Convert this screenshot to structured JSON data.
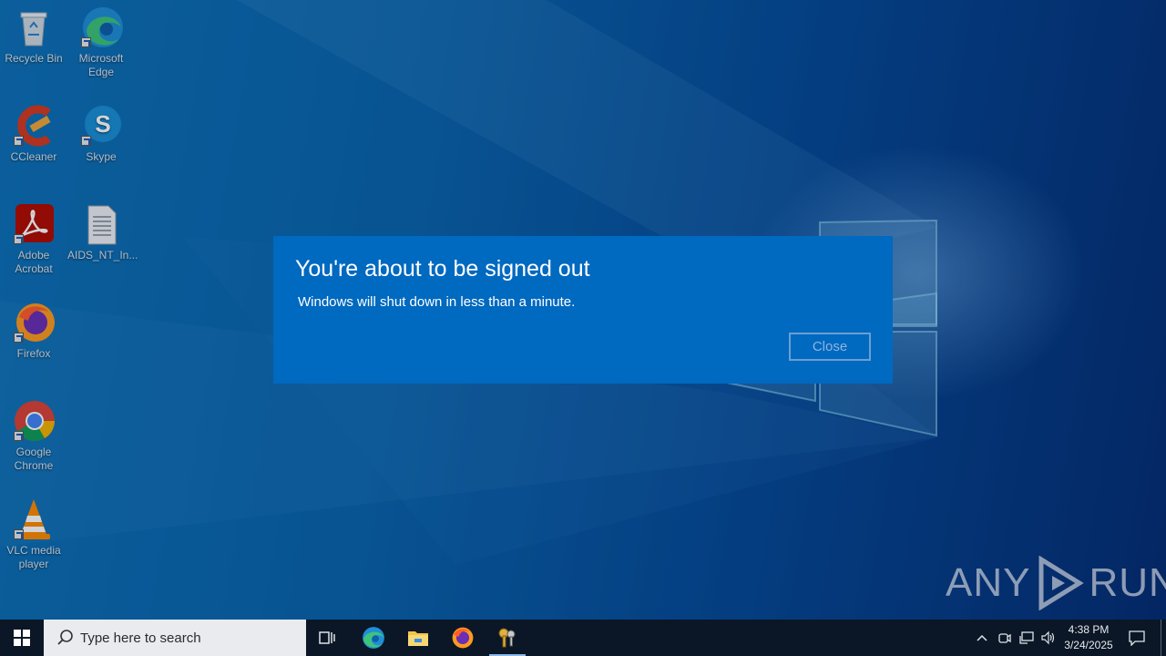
{
  "desktop": {
    "icons": [
      {
        "label": "Recycle Bin",
        "icon": "recycle-bin-icon"
      },
      {
        "label": "Microsoft Edge",
        "icon": "edge-icon"
      },
      {
        "label": "CCleaner",
        "icon": "ccleaner-icon"
      },
      {
        "label": "Skype",
        "icon": "skype-icon"
      },
      {
        "label": "Adobe Acrobat",
        "icon": "acrobat-icon"
      },
      {
        "label": "AIDS_NT_In...",
        "icon": "text-file-icon"
      },
      {
        "label": "Firefox",
        "icon": "firefox-icon"
      },
      {
        "label": "Google Chrome",
        "icon": "chrome-icon"
      },
      {
        "label": "VLC media player",
        "icon": "vlc-icon"
      }
    ]
  },
  "dialog": {
    "title": "You're about to be signed out",
    "message": "Windows will shut down in less than a minute.",
    "close_label": "Close",
    "background_color": "#0069c0"
  },
  "watermark": {
    "left": "ANY",
    "right": "RUN"
  },
  "taskbar": {
    "search_placeholder": "Type here to search",
    "pinned": [
      "task-view-icon",
      "edge-icon",
      "file-explorer-icon",
      "firefox-icon",
      "keys-app-icon"
    ],
    "clock_time": "4:38 PM",
    "clock_date": "3/24/2025"
  }
}
